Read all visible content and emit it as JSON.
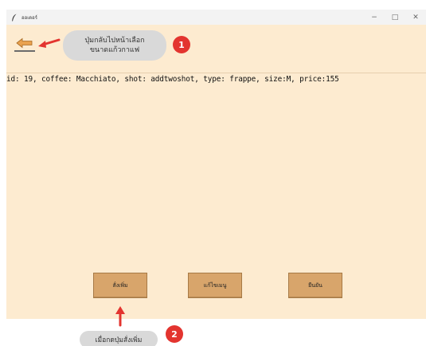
{
  "window": {
    "title": "ออเดอร์",
    "minimize_glyph": "−",
    "maximize_glyph": "□",
    "close_glyph": "✕"
  },
  "order": {
    "summary_line": "id: 19, coffee: Macchiato, shot: addtwoshot, type: frappe, size:M, price:155"
  },
  "buttons": {
    "order_more": "สั่งเพิ่ม",
    "edit_menu": "แก้ไขเมนู",
    "confirm": "ยืนยัน"
  },
  "annotations": {
    "callout_1_line1": "ปุ่มกลับไปหน้าเลือก",
    "callout_1_line2": "ขนาดแก้วกาแฟ",
    "badge_1": "1",
    "callout_2": "เมื่อกดปุ่มสั่งเพิ่ม",
    "badge_2": "2"
  },
  "colors": {
    "app_background": "#fdebd0",
    "button_fill": "#d8a56b",
    "annotation_red": "#e3342f",
    "callout_gray": "#d9d9d9"
  },
  "icons": {
    "back": "back-arrow-icon",
    "app": "feather-icon"
  }
}
